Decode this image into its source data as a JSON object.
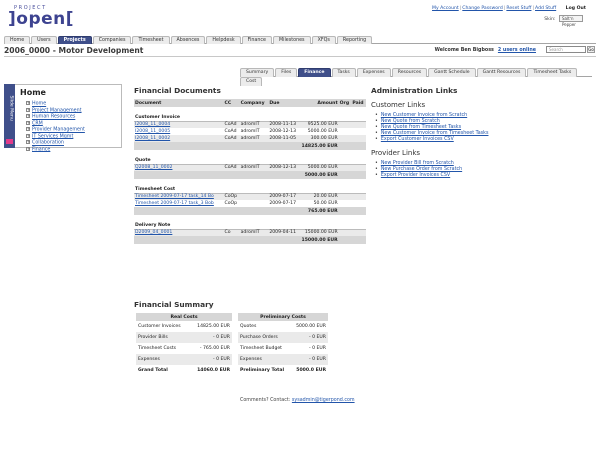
{
  "logo": {
    "small": "PROJECT",
    "big": "]open["
  },
  "top_links": {
    "account": "My Account",
    "change_password": "Change Password",
    "reset_stuff": "Reset Stuff",
    "add_stuff": "Add Stuff",
    "logout": "Log Out"
  },
  "skin": {
    "label": "Skin:",
    "value": "Saltʼn Pepper"
  },
  "main_tabs": [
    "Home",
    "Users",
    "Projects",
    "Companies",
    "Timesheet",
    "Absences",
    "Helpdesk",
    "Finance",
    "Milestones",
    "XFQs",
    "Reporting"
  ],
  "main_tabs_active": "Projects",
  "project": {
    "title": "2006_0000 - Motor Development",
    "welcome": "Welcome Ben Bigboss",
    "online": "2 users online",
    "search_placeholder": "Search",
    "go": "Go"
  },
  "sub_tabs": [
    "Summary",
    "Files",
    "Finance",
    "Tasks",
    "Expenses",
    "Resources",
    "Gantt Schedule",
    "Gantt Resources",
    "Timesheet Tasks",
    "Cost"
  ],
  "sidebar": {
    "strip_label": "Slide Menu",
    "title": "Home",
    "items": [
      "Home",
      "Project Management",
      "Human Resources",
      "CRM",
      "Provider Management",
      "IT Services Mgmt",
      "Collaboration",
      "Finance"
    ]
  },
  "fin_docs": {
    "title": "Financial Documents",
    "headers": [
      "Document",
      "CC",
      "Company",
      "Due",
      "Amount",
      "Org",
      "Paid"
    ],
    "groups": [
      {
        "name": "Customer Invoice",
        "rows": [
          [
            "I2008_11_0004",
            "CoAd",
            "adromIT",
            "2008-11-13",
            "9525.00 EUR"
          ],
          [
            "I2008_11_0005",
            "CoAd",
            "adromIT",
            "2008-12-13",
            "5000.00 EUR"
          ],
          [
            "I2008_11_0002",
            "CoAd",
            "adromIT",
            "2008-11-05",
            "300.00 EUR"
          ]
        ],
        "total": "14825.00 EUR"
      },
      {
        "name": "Quote",
        "rows": [
          [
            "Q2008_11_0002",
            "CoAd",
            "adromIT",
            "2008-12-13",
            "5000.00 EUR"
          ]
        ],
        "total": "5000.00 EUR"
      },
      {
        "name": "Timesheet Cost",
        "rows": [
          [
            "Timesheet 2009-07-17 task_14 Bo",
            "CoOp",
            "",
            "2009-07-17",
            "20.00 EUR"
          ],
          [
            "Timesheet 2009-07-17 task_3 Bob",
            "CoOp",
            "",
            "2009-07-17",
            "50.00 EUR"
          ]
        ],
        "total": "765.00 EUR"
      },
      {
        "name": "Delivery Note",
        "rows": [
          [
            "D2009_04_0001",
            "Co",
            "adromIT",
            "2009-04-11",
            "15000.00 EUR"
          ]
        ],
        "total": "15000.00 EUR"
      }
    ]
  },
  "admin": {
    "title": "Administration Links",
    "customer_title": "Customer Links",
    "customer_links": [
      "New Customer Invoice from Scratch",
      "New Quote from Scratch",
      "New Quote from Timesheet Tasks",
      "New Customer Invoice from Timesheet Tasks",
      "Export Customer Invoices CSV"
    ],
    "provider_title": "Provider Links",
    "provider_links": [
      "New Provider Bill from Scratch",
      "New Purchase Order from Scratch",
      "Export Provider Invoices CSV"
    ]
  },
  "summary": {
    "title": "Financial Summary",
    "real_header": "Real Costs",
    "real_rows": [
      [
        "Customer Invoices",
        "14825.00 EUR"
      ],
      [
        "Provider Bills",
        "- 0 EUR"
      ],
      [
        "Timesheet Costs",
        "- 765.00 EUR"
      ],
      [
        "Expenses",
        "- 0 EUR"
      ],
      [
        "Grand Total",
        "14060.0 EUR"
      ]
    ],
    "prelim_header": "Preliminary Costs",
    "prelim_rows": [
      [
        "Quotes",
        "5000.00 EUR"
      ],
      [
        "Purchase Orders",
        "- 0 EUR"
      ],
      [
        "Timesheet Budget",
        "- 0 EUR"
      ],
      [
        "Expenses",
        "- 0 EUR"
      ],
      [
        "Preliminary Total",
        "5000.0 EUR"
      ]
    ]
  },
  "footer": {
    "text": "Comments? Contact:",
    "email": "sysadmin@tigerpond.com"
  }
}
